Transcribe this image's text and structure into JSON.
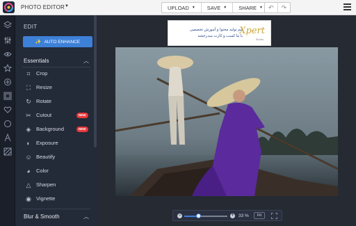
{
  "header": {
    "app_title": "PHOTO EDITOR",
    "upload_label": "UPLOAD",
    "save_label": "SAVE",
    "share_label": "SHARE",
    "undo_icon": "undo-icon",
    "redo_icon": "redo-icon",
    "menu_icon": "hamburger-menu-icon"
  },
  "rail": {
    "icons": [
      "layers-icon",
      "sliders-icon",
      "eye-icon",
      "star-icon",
      "texture-icon",
      "frame-icon",
      "heart-icon",
      "shape-icon",
      "text-icon",
      "pattern-icon"
    ]
  },
  "panel": {
    "title": "EDIT",
    "auto_enhance_label": "AUTO ENHANCE",
    "essentials": {
      "label": "Essentials",
      "tools": [
        {
          "label": "Crop",
          "icon": "crop-icon",
          "glyph": "⌗",
          "badge": ""
        },
        {
          "label": "Resize",
          "icon": "resize-icon",
          "glyph": "⛶",
          "badge": ""
        },
        {
          "label": "Rotate",
          "icon": "rotate-icon",
          "glyph": "↻",
          "badge": ""
        },
        {
          "label": "Cutout",
          "icon": "cutout-icon",
          "glyph": "✂",
          "badge": "NEW"
        },
        {
          "label": "Background",
          "icon": "background-icon",
          "glyph": "◈",
          "badge": "NEW"
        },
        {
          "label": "Exposure",
          "icon": "exposure-icon",
          "glyph": "◐",
          "badge": ""
        },
        {
          "label": "Beautify",
          "icon": "beautify-icon",
          "glyph": "☺",
          "badge": ""
        },
        {
          "label": "Color",
          "icon": "color-icon",
          "glyph": "◕",
          "badge": ""
        },
        {
          "label": "Sharpen",
          "icon": "sharpen-icon",
          "glyph": "△",
          "badge": ""
        },
        {
          "label": "Vignette",
          "icon": "vignette-icon",
          "glyph": "◉",
          "badge": ""
        }
      ]
    },
    "blur_section": {
      "label": "Blur & Smooth"
    }
  },
  "ad": {
    "line1": "تیم تولید محتوا و آموزش تخصصی",
    "line2": "با ما کسب و کارت میدرخشه",
    "brand": "Xpert",
    "brand_sub": "Studio"
  },
  "zoom": {
    "value_label": "33 %",
    "level": 0.33,
    "fit_label": "Fit",
    "fullscreen_icon": "fullscreen-icon"
  },
  "colors": {
    "accent": "#3d80d8",
    "badge": "#e8383b",
    "panel_bg": "#232a38"
  }
}
